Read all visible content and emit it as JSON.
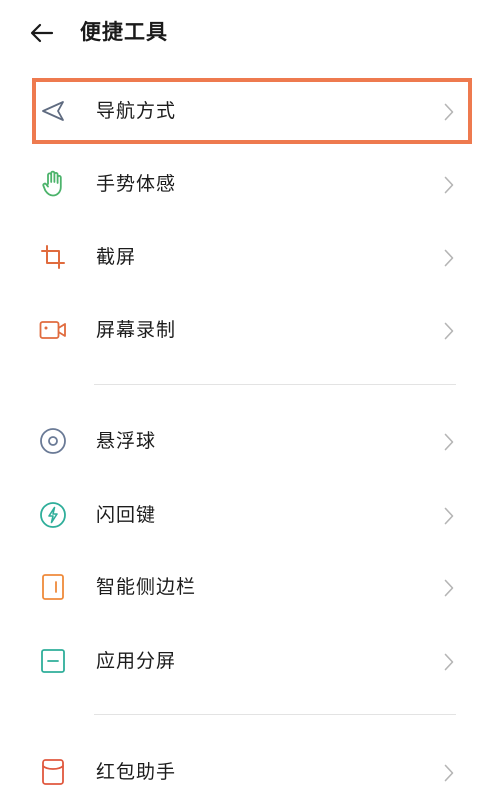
{
  "header": {
    "title": "便捷工具",
    "back_icon": "arrow-left-icon"
  },
  "colors": {
    "highlight_border": "#ee7a4f",
    "chevron": "#b5b5b5",
    "navigation_icon": "#5f6b80",
    "gesture_icon": "#4cb36b",
    "screenshot_icon": "#e06b3e",
    "screen_record_icon": "#e06b3e",
    "floating_ball_icon": "#6a7a96",
    "flash_key_icon": "#2fae9a",
    "smart_sidebar_icon": "#ef8a3b",
    "split_screen_icon": "#2fae9a",
    "red_envelope_icon": "#e0583e"
  },
  "groups": [
    {
      "items": [
        {
          "label": "导航方式",
          "icon": "navigation-arrow-icon",
          "highlighted": true
        },
        {
          "label": "手势体感",
          "icon": "hand-gesture-icon"
        },
        {
          "label": "截屏",
          "icon": "crop-screenshot-icon"
        },
        {
          "label": "屏幕录制",
          "icon": "video-camera-icon"
        }
      ]
    },
    {
      "items": [
        {
          "label": "悬浮球",
          "icon": "floating-ball-icon"
        },
        {
          "label": "闪回键",
          "icon": "lightning-icon"
        },
        {
          "label": "智能侧边栏",
          "icon": "sidebar-icon"
        },
        {
          "label": "应用分屏",
          "icon": "split-screen-icon"
        }
      ]
    },
    {
      "items": [
        {
          "label": "红包助手",
          "icon": "red-envelope-icon"
        }
      ]
    }
  ]
}
